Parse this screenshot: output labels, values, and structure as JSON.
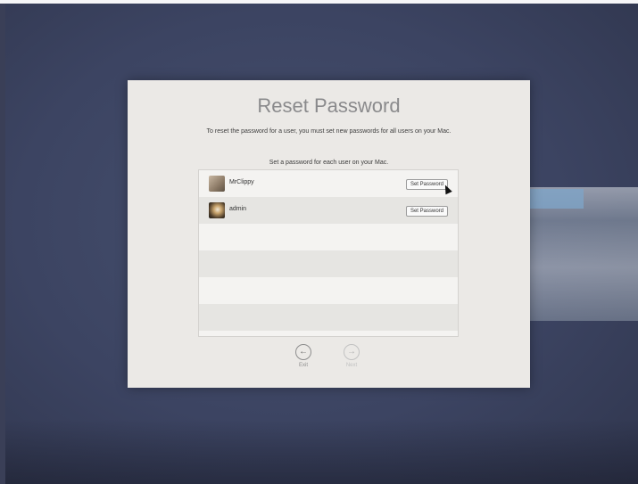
{
  "dialog": {
    "title": "Reset Password",
    "description": "To reset the password for a user, you must set new passwords for all users on your Mac.",
    "instruction": "Set a password for each user on your Mac."
  },
  "users": [
    {
      "name": "MrClippy",
      "button": "Set Password"
    },
    {
      "name": "admin",
      "button": "Set Password"
    }
  ],
  "nav": {
    "exit_label": "Exit",
    "next_label": "Next",
    "exit_icon": "arrow-left-circle-icon",
    "next_icon": "arrow-right-circle-icon"
  },
  "colors": {
    "background": "#3c4462",
    "dialog": "#ebe9e6",
    "title": "#8a8a8c"
  }
}
